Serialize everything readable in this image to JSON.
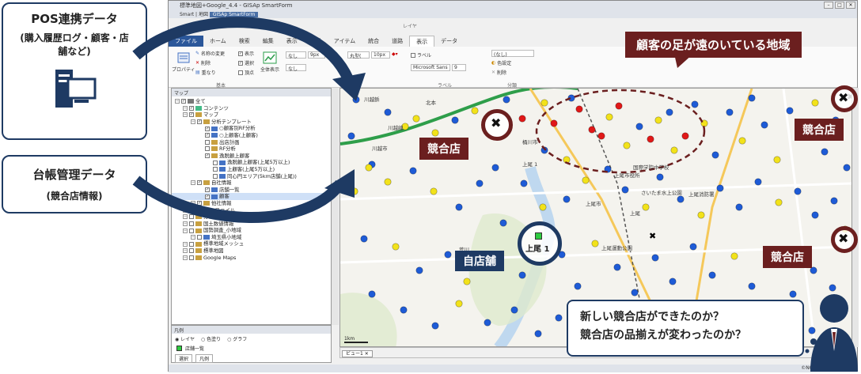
{
  "window": {
    "title": "標準地図+Google_4.4 - GISAp SmartForm",
    "app_title": "GISAp SmartForm",
    "quick_bar": "Smart | 地図"
  },
  "ribbon": {
    "context_label": "レイヤ",
    "tabs": [
      "ファイル",
      "ホーム",
      "検索",
      "編集",
      "表示",
      "分析",
      "アイテム",
      "統合",
      "道路",
      "表示",
      "データ"
    ],
    "properties_label": "プロパティ",
    "name_change": "名称の変更",
    "delete": "削除",
    "order": "重なり",
    "show": "表示",
    "select": "選択",
    "vertex": "頂点",
    "full_display": "全体表示",
    "basic_group": "基本",
    "font_none": "なし",
    "font_size": "9px",
    "shape": "丸型(",
    "size": "10px",
    "label_check": "ラベル",
    "font_name": "Microsoft Sans",
    "font_num": "9",
    "label_group": "ラベル",
    "none2": "(なし)",
    "color_settings": "色設定",
    "delete2": "削除",
    "classify_group": "分類"
  },
  "layer_pane": {
    "title": "マップ",
    "items": [
      {
        "label": "全て",
        "depth": 0,
        "icon": "#777"
      },
      {
        "label": "コンテンツ",
        "depth": 1,
        "icon": "#4b8"
      },
      {
        "label": "マップ",
        "depth": 1,
        "icon": "#c8a040"
      },
      {
        "label": "分析テンプレート",
        "depth": 2,
        "icon": "#c8a040"
      },
      {
        "label": "○顧客別RF分析",
        "depth": 3,
        "icon": "#4472c4"
      },
      {
        "label": "○上顧客(上顧客)",
        "depth": 3,
        "icon": "#4472c4"
      },
      {
        "label": "出店計画",
        "depth": 3,
        "icon": "#c8a040"
      },
      {
        "label": "RF分析",
        "depth": 3,
        "icon": "#c8a040"
      },
      {
        "label": "逸脱顧上顧客",
        "depth": 3,
        "icon": "#c8a040"
      },
      {
        "label": "逸脱顧上顧客(上尾5万以上)",
        "depth": 4,
        "icon": "#4472c4"
      },
      {
        "label": "上顧客(上尾5万以上)",
        "depth": 4,
        "icon": "#4472c4"
      },
      {
        "label": "同心円エリア(5km店舗(上尾))",
        "depth": 4,
        "icon": "#4472c4"
      },
      {
        "label": "自社情報",
        "depth": 2,
        "icon": "#c8a040"
      },
      {
        "label": "店舗一覧",
        "depth": 3,
        "icon": "#4472c4"
      },
      {
        "label": "顧客",
        "depth": 3,
        "icon": "#4472c4"
      },
      {
        "label": "他社情報",
        "depth": 2,
        "icon": "#c8a040"
      },
      {
        "label": "FSD ファイル",
        "depth": 1,
        "icon": "#c8a040"
      },
      {
        "label": "分析エリア",
        "depth": 1,
        "icon": "#c8a040"
      },
      {
        "label": "国土数値情報",
        "depth": 1,
        "icon": "#c8a040"
      },
      {
        "label": "国勢調査_小地域",
        "depth": 1,
        "icon": "#c8a040"
      },
      {
        "label": "埼玉県小地域",
        "depth": 2,
        "icon": "#4472c4"
      },
      {
        "label": "標準地域メッシュ",
        "depth": 1,
        "icon": "#c8a040"
      },
      {
        "label": "標準地図",
        "depth": 1,
        "icon": "#c8a040"
      },
      {
        "label": "Google Maps",
        "depth": 1,
        "icon": "#c8a040"
      }
    ]
  },
  "legend_pane": {
    "title": "凡例",
    "radio": [
      "レイヤ",
      "色塗り",
      "グラフ"
    ],
    "item": "店舗一覧",
    "tabs": [
      "選択",
      "凡例"
    ]
  },
  "map": {
    "view_tab": "ビュー1",
    "scale": "1km",
    "credit": "©NOSTRA",
    "labels": [
      "川越鋲",
      "川越市",
      "上尾市",
      "桶川市",
      "国際学院中学校",
      "上尾市役所",
      "上尾",
      "北本",
      "上尾消防署",
      "川越線",
      "さいたま水上公園",
      "上尾運動公園",
      "荒川",
      "上尾 1"
    ],
    "store": "上尾 1",
    "competitor_store": "漢田"
  },
  "overlay": {
    "left_box1_title": "POS連携データ",
    "left_box1_sub": "(購入履歴ログ・顧客・店舗など)",
    "left_box2_title": "台帳管理データ",
    "left_box2_sub": "(競合店情報)",
    "callout_far": "顧客の足が遠のいている地域",
    "competitor_label": "競合店",
    "own_store_label": "自店舗",
    "question_line1": "新しい競合店ができたのか？",
    "question_line2": "競合店の品揃えが変わったのか？"
  },
  "colors": {
    "navy": "#1e3a63",
    "maroon": "#6b1f1f",
    "marker_blue": "#1e5bd6",
    "marker_yellow": "#f2e21a",
    "marker_red": "#e01818"
  }
}
